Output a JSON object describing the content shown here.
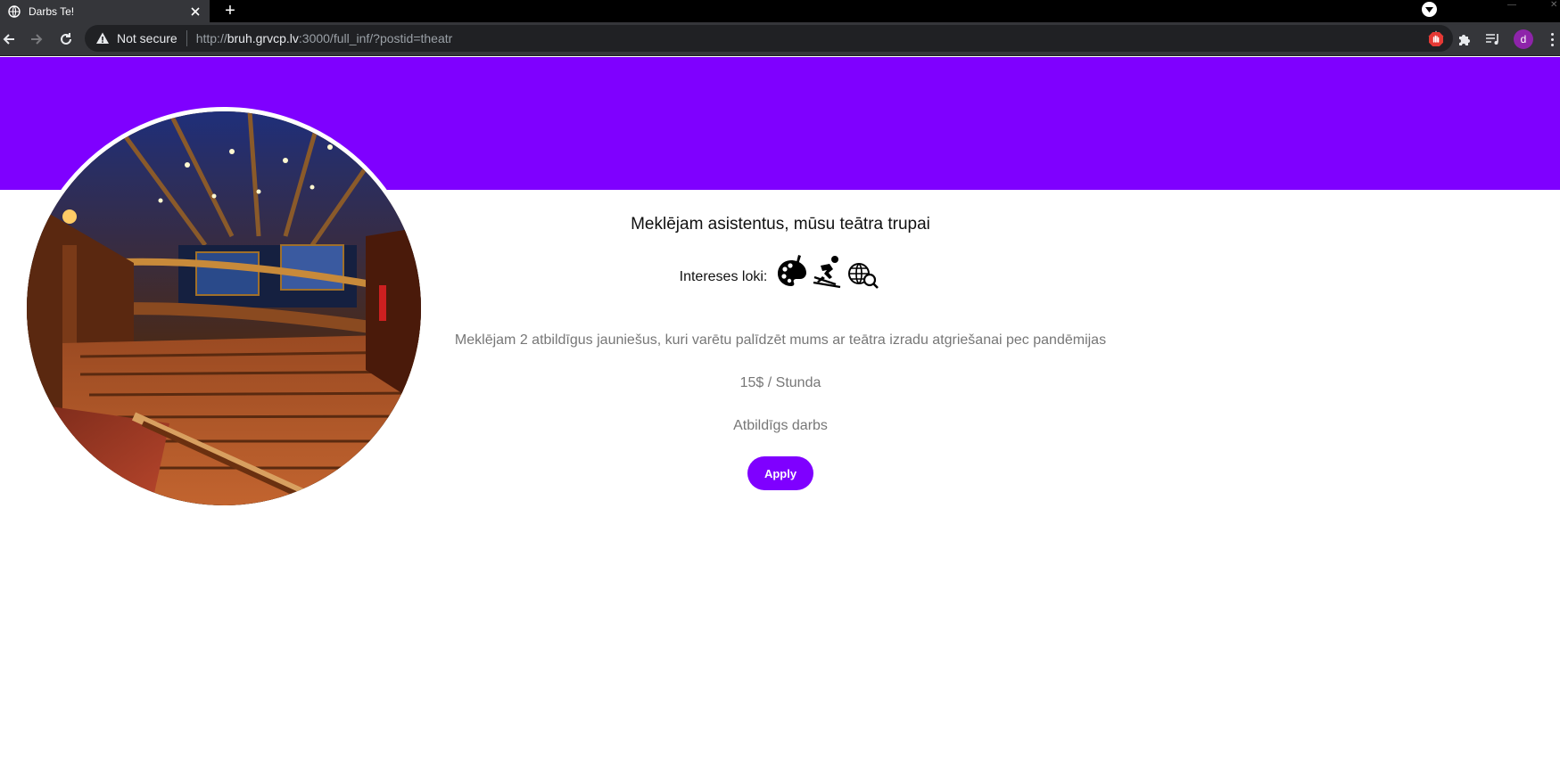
{
  "browser": {
    "tab_title": "Darbs Te!",
    "new_tab_symbol": "+",
    "security_label": "Not secure",
    "url_scheme": "http://",
    "url_host": "bruh.grvcp.lv",
    "url_rest": ":3000/full_inf/?postid=theatr",
    "avatar_letter": "d",
    "icons": [
      "globe-icon",
      "close-icon",
      "plus-icon",
      "tab-search-icon",
      "back-icon",
      "forward-icon",
      "reload-icon",
      "warning-icon",
      "star-icon",
      "stop-hand-extension-icon",
      "puzzle-icon",
      "reading-list-icon",
      "menu-icon"
    ]
  },
  "colors": {
    "accent": "#7f00ff",
    "text_primary": "#111111",
    "text_muted": "#777777"
  },
  "job": {
    "title": "Meklējam asistentus, mūsu teātra trupai",
    "interests_label": "Intereses loki:",
    "interest_icons": [
      "art-palette-icon",
      "skiing-icon",
      "global-search-icon"
    ],
    "description": "Meklējam 2 atbildīgus jauniešus, kuri varētu palīdzēt mums ar teātra izradu atgriešanai pec pandēmijas",
    "price": "15$ / Stunda",
    "work_type": "Atbildīgs darbs",
    "apply_label": "Apply",
    "image_name": "theatre-photo"
  }
}
